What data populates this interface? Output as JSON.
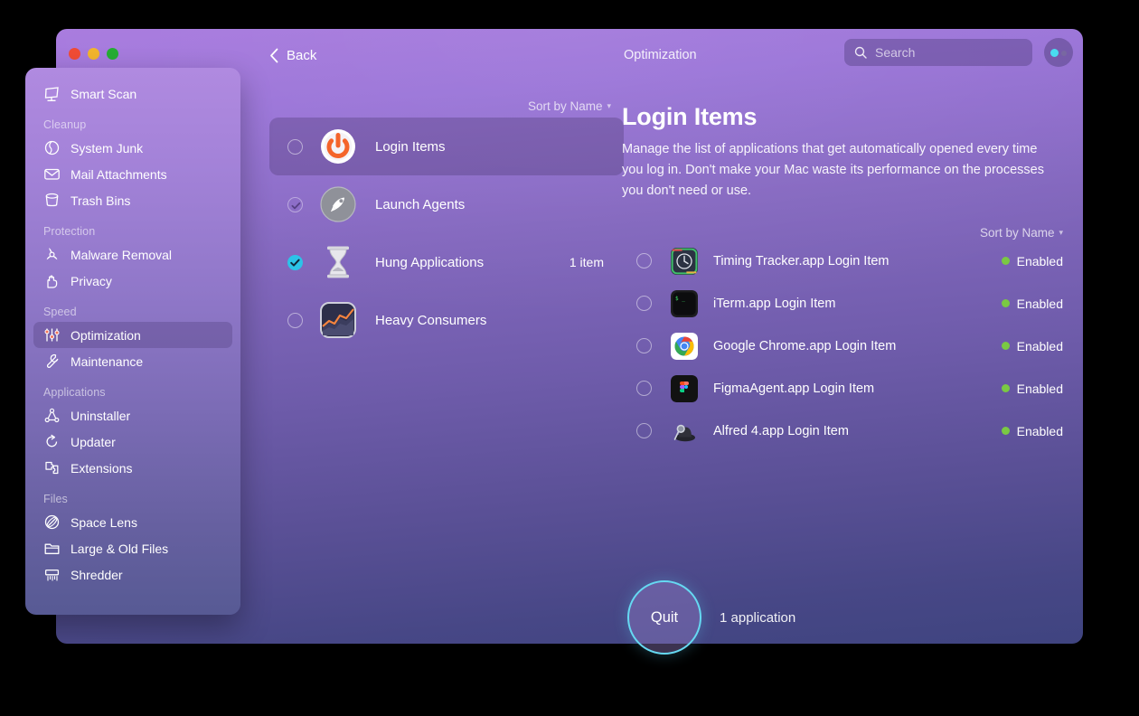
{
  "window": {
    "module_title": "Optimization",
    "back_label": "Back",
    "traffic_lights": [
      "close-red",
      "minimize-yellow",
      "zoom-green"
    ]
  },
  "search": {
    "placeholder": "Search",
    "icon": "search-icon",
    "value": ""
  },
  "account_button": {
    "icon": "account-status-icon"
  },
  "sidebar": {
    "groups": [
      {
        "label": "",
        "items": [
          {
            "label": "Smart Scan",
            "icon": "smart-scan-icon",
            "active": false
          }
        ]
      },
      {
        "label": "Cleanup",
        "items": [
          {
            "label": "System Junk",
            "icon": "system-junk-icon",
            "active": false
          },
          {
            "label": "Mail Attachments",
            "icon": "mail-attachments-icon",
            "active": false
          },
          {
            "label": "Trash Bins",
            "icon": "trash-bins-icon",
            "active": false
          }
        ]
      },
      {
        "label": "Protection",
        "items": [
          {
            "label": "Malware Removal",
            "icon": "malware-removal-icon",
            "active": false
          },
          {
            "label": "Privacy",
            "icon": "privacy-icon",
            "active": false
          }
        ]
      },
      {
        "label": "Speed",
        "items": [
          {
            "label": "Optimization",
            "icon": "optimization-icon",
            "active": true
          },
          {
            "label": "Maintenance",
            "icon": "maintenance-icon",
            "active": false
          }
        ]
      },
      {
        "label": "Applications",
        "items": [
          {
            "label": "Uninstaller",
            "icon": "uninstaller-icon",
            "active": false
          },
          {
            "label": "Updater",
            "icon": "updater-icon",
            "active": false
          },
          {
            "label": "Extensions",
            "icon": "extensions-icon",
            "active": false
          }
        ]
      },
      {
        "label": "Files",
        "items": [
          {
            "label": "Space Lens",
            "icon": "space-lens-icon",
            "active": false
          },
          {
            "label": "Large & Old Files",
            "icon": "large-old-files-icon",
            "active": false
          },
          {
            "label": "Shredder",
            "icon": "shredder-icon",
            "active": false
          }
        ]
      }
    ]
  },
  "middle_list": {
    "sort_label": "Sort by Name",
    "rows": [
      {
        "name": "Login Items",
        "icon": "power-button-icon",
        "checkbox": "empty",
        "count": "",
        "selected": true
      },
      {
        "name": "Launch Agents",
        "icon": "rocket-icon",
        "checkbox": "dim",
        "count": "",
        "selected": false
      },
      {
        "name": "Hung Applications",
        "icon": "hourglass-icon",
        "checkbox": "checked",
        "count": "1 item",
        "selected": false
      },
      {
        "name": "Heavy Consumers",
        "icon": "activity-chart-icon",
        "checkbox": "empty",
        "count": "",
        "selected": false
      }
    ]
  },
  "detail": {
    "title": "Login Items",
    "description": "Manage the list of applications that get automatically opened every time you log in. Don't make your Mac waste its performance on the processes you don't need or use.",
    "sort_label": "Sort by Name",
    "items": [
      {
        "name": "Timing Tracker.app Login Item",
        "icon": "timing-tracker-app-icon",
        "status": "Enabled",
        "checkbox": "empty"
      },
      {
        "name": "iTerm.app Login Item",
        "icon": "iterm-app-icon",
        "status": "Enabled",
        "checkbox": "empty"
      },
      {
        "name": "Google Chrome.app Login Item",
        "icon": "google-chrome-app-icon",
        "status": "Enabled",
        "checkbox": "empty"
      },
      {
        "name": "FigmaAgent.app Login Item",
        "icon": "figma-agent-app-icon",
        "status": "Enabled",
        "checkbox": "empty"
      },
      {
        "name": "Alfred 4.app Login Item",
        "icon": "alfred-app-icon",
        "status": "Enabled",
        "checkbox": "empty"
      }
    ]
  },
  "footer": {
    "action_label": "Quit",
    "count_label": "1 application"
  },
  "colors": {
    "accent_cyan": "#2cc3e8",
    "status_green": "#7ac943",
    "bg_top": "#a87ade",
    "bg_bottom": "#3f4480",
    "traffic_red": "#f04c35",
    "traffic_yellow": "#f2b52c",
    "traffic_green": "#26ad34"
  }
}
